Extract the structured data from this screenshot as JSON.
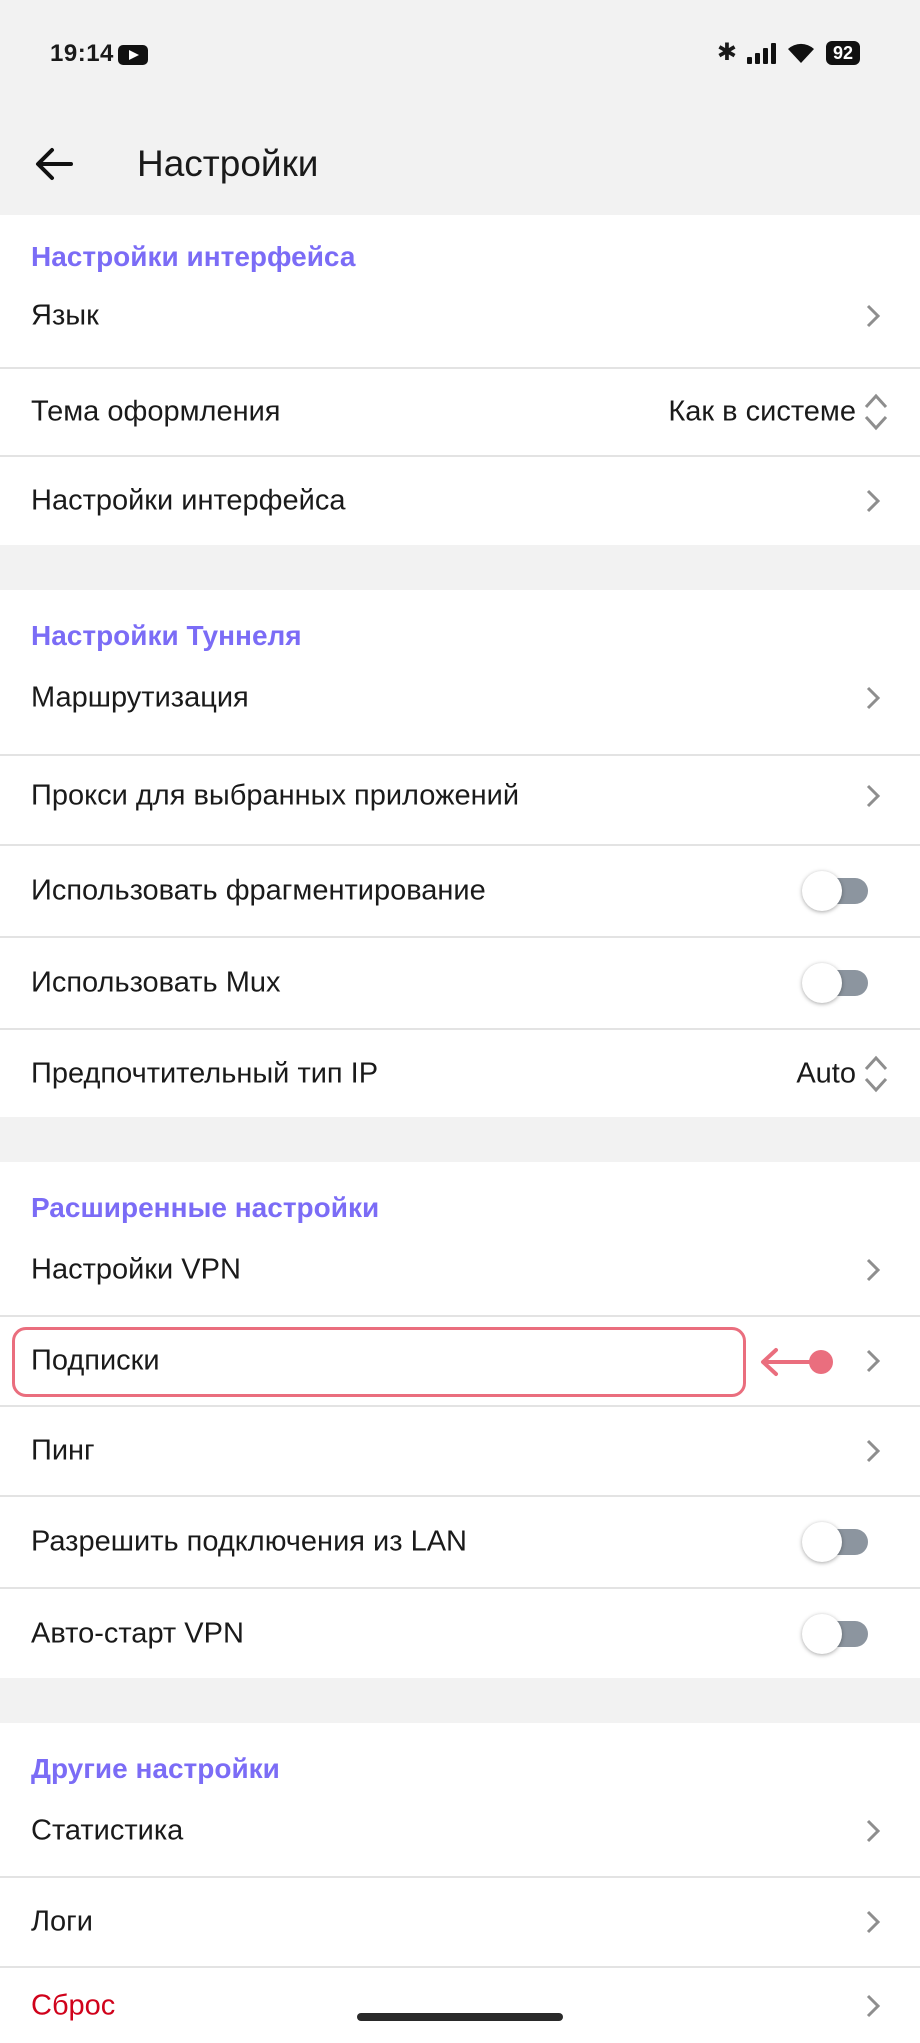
{
  "status_bar": {
    "time": "19:14",
    "battery": "92"
  },
  "app_bar": {
    "title": "Настройки"
  },
  "sections": [
    {
      "title": "Настройки интерфейса",
      "items": [
        {
          "label": "Язык"
        },
        {
          "label": "Тема оформления",
          "value": "Как в системе"
        },
        {
          "label": "Настройки интерфейса"
        }
      ]
    },
    {
      "title": "Настройки Туннеля",
      "items": [
        {
          "label": "Маршрутизация"
        },
        {
          "label": "Прокси для выбранных приложений"
        },
        {
          "label": "Использовать фрагментирование",
          "toggle": false
        },
        {
          "label": "Использовать Mux",
          "toggle": false
        },
        {
          "label": "Предпочтительный тип IP",
          "value": "Auto"
        }
      ]
    },
    {
      "title": "Расширенные настройки",
      "items": [
        {
          "label": "Настройки VPN"
        },
        {
          "label": "Подписки",
          "highlighted": true
        },
        {
          "label": "Пинг"
        },
        {
          "label": "Разрешить подключения из LAN",
          "toggle": false
        },
        {
          "label": "Авто-старт VPN",
          "toggle": false
        }
      ]
    },
    {
      "title": "Другие настройки",
      "items": [
        {
          "label": "Статистика"
        },
        {
          "label": "Логи"
        },
        {
          "label": "Сброс",
          "color": "#d0021b"
        }
      ]
    }
  ],
  "colors": {
    "accent": "#7b6cf6",
    "highlight": "#ea6e7e",
    "danger": "#d0021b",
    "toggle_off": "#8c959f"
  },
  "icons": {
    "back": "arrow-left-icon",
    "chevron": "chevron-right-icon",
    "updown": "chevron-up-down-icon",
    "annotation": "arrow-left-pointer-icon"
  }
}
